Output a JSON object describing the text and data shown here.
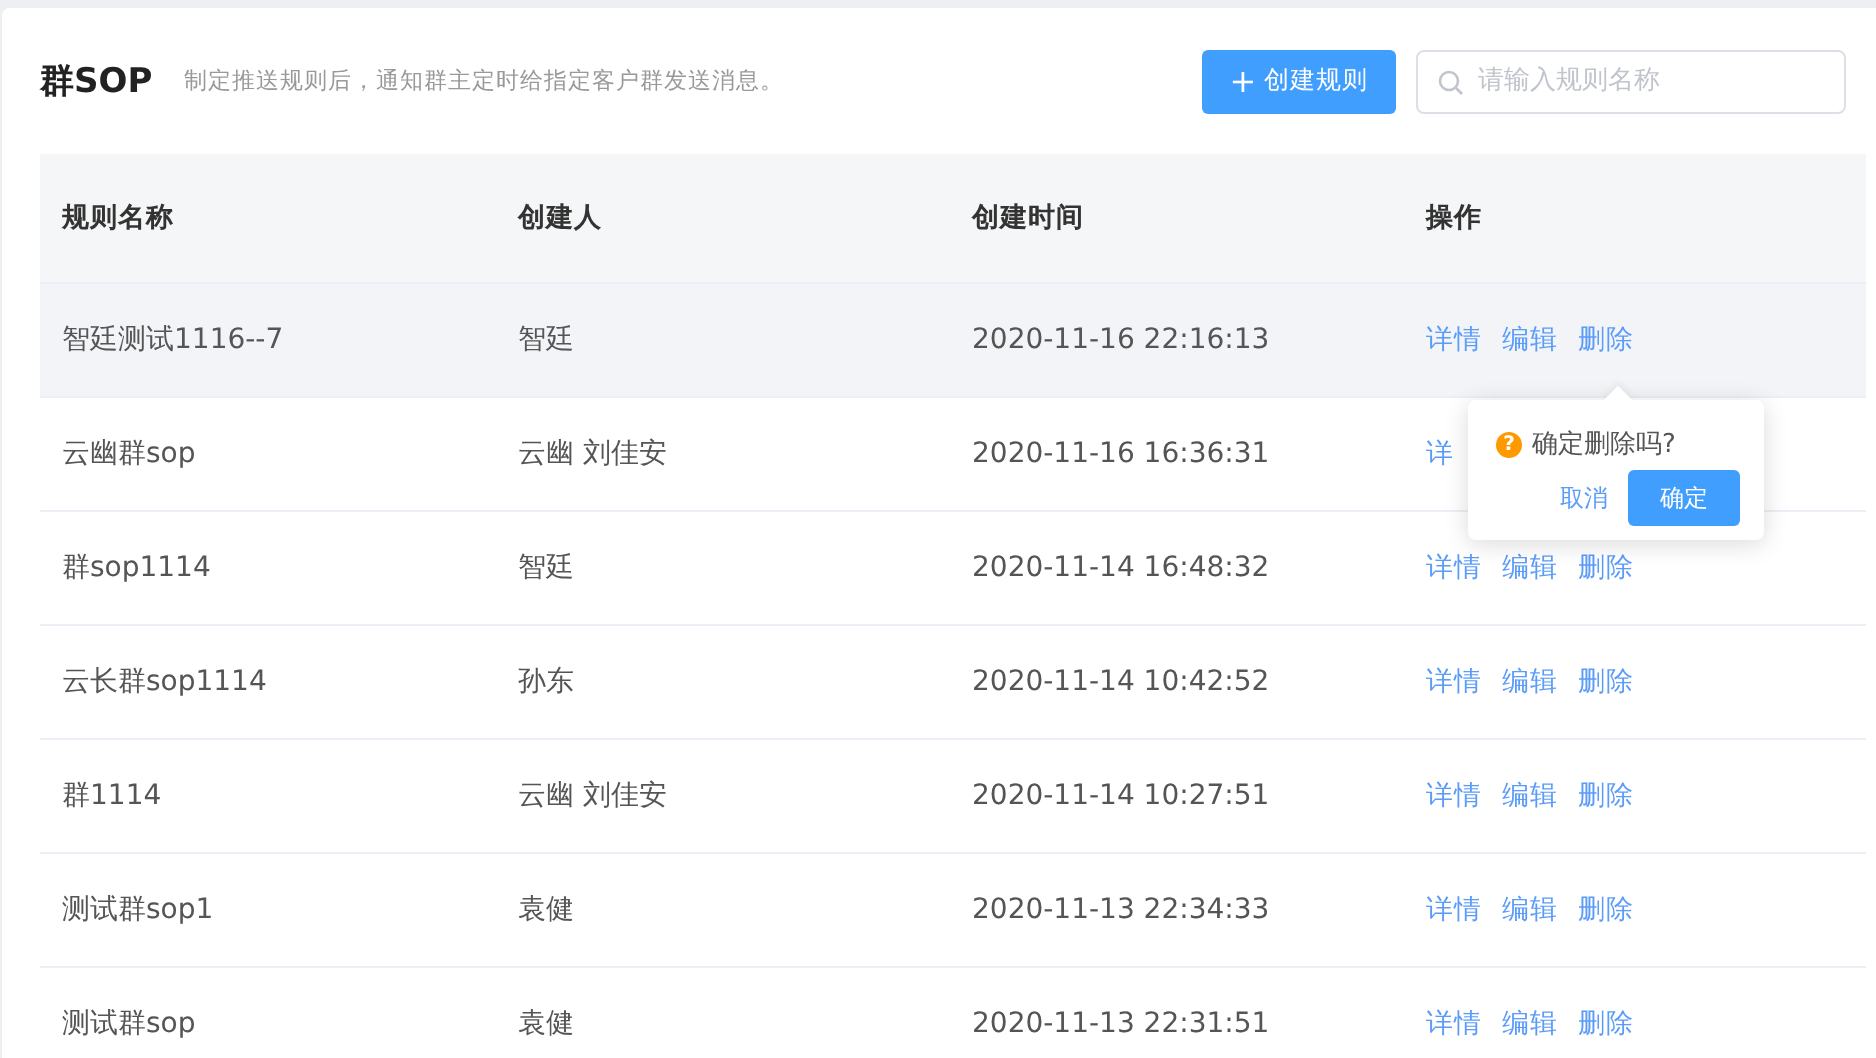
{
  "header": {
    "title": "群SOP",
    "description": "制定推送规则后，通知群主定时给指定客户群发送消息。",
    "create_button": {
      "icon": "+",
      "label": "创建规则"
    },
    "search": {
      "placeholder": "请输入规则名称"
    }
  },
  "table": {
    "columns": [
      "规则名称",
      "创建人",
      "创建时间",
      "操作"
    ],
    "rows": [
      {
        "name": "智廷测试1116--7",
        "creator": "智廷",
        "created": "2020-11-16 22:16:13",
        "highlighted": true,
        "actions": [
          "详情",
          "编辑",
          "删除"
        ],
        "popconfirm": {
          "icon": "?",
          "message": "确定删除吗?",
          "cancel": "取消",
          "confirm": "确定"
        }
      },
      {
        "name": "云幽群sop",
        "creator": "云幽 刘佳安",
        "created": "2020-11-16 16:36:31",
        "highlighted": false,
        "actions": [
          "详"
        ]
      },
      {
        "name": "群sop1114",
        "creator": "智廷",
        "created": "2020-11-14 16:48:32",
        "highlighted": false,
        "actions": [
          "详情",
          "编辑",
          "删除"
        ]
      },
      {
        "name": "云长群sop1114",
        "creator": "孙东",
        "created": "2020-11-14 10:42:52",
        "highlighted": false,
        "actions": [
          "详情",
          "编辑",
          "删除"
        ]
      },
      {
        "name": "群1114",
        "creator": "云幽 刘佳安",
        "created": "2020-11-14 10:27:51",
        "highlighted": false,
        "actions": [
          "详情",
          "编辑",
          "删除"
        ]
      },
      {
        "name": "测试群sop1",
        "creator": "袁健",
        "created": "2020-11-13 22:34:33",
        "highlighted": false,
        "actions": [
          "详情",
          "编辑",
          "删除"
        ]
      },
      {
        "name": "测试群sop",
        "creator": "袁健",
        "created": "2020-11-13 22:31:51",
        "highlighted": false,
        "actions": [
          "详情",
          "编辑",
          "删除"
        ]
      }
    ]
  }
}
